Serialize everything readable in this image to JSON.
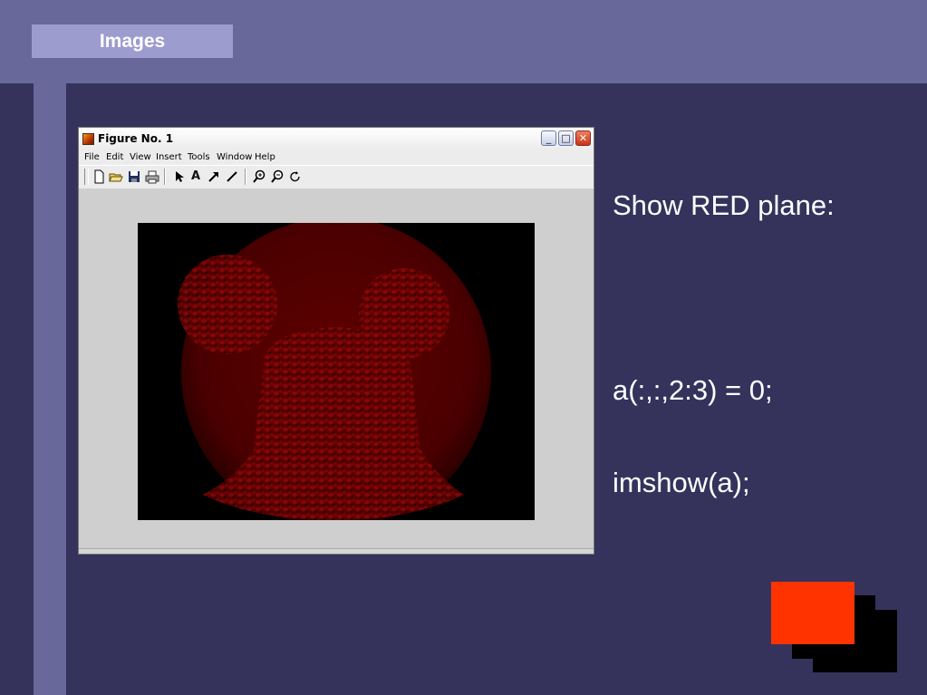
{
  "slide": {
    "title": "Images",
    "text_heading": "Show RED plane:",
    "code_lines": [
      "a(:,:,2:3) = 0;",
      "imshow(a);"
    ]
  },
  "figure_window": {
    "title": "Figure No. 1",
    "menu": [
      "File",
      "Edit",
      "View",
      "Insert",
      "Tools",
      "Window",
      "Help"
    ],
    "toolbar_icons": [
      "new-file-icon",
      "open-folder-icon",
      "save-icon",
      "print-icon",
      "pointer-arrow-icon",
      "text-a-icon",
      "arrow-icon",
      "line-icon",
      "zoom-in-icon",
      "zoom-out-icon",
      "rotate-icon"
    ],
    "image_description_colors": {
      "background": "#000000",
      "red_plane": "#6a0000"
    }
  },
  "colors": {
    "slide_background": "#35335c",
    "band": "#68689b",
    "title_box": "#9c9ccf",
    "accent_red": "#ff3300"
  }
}
